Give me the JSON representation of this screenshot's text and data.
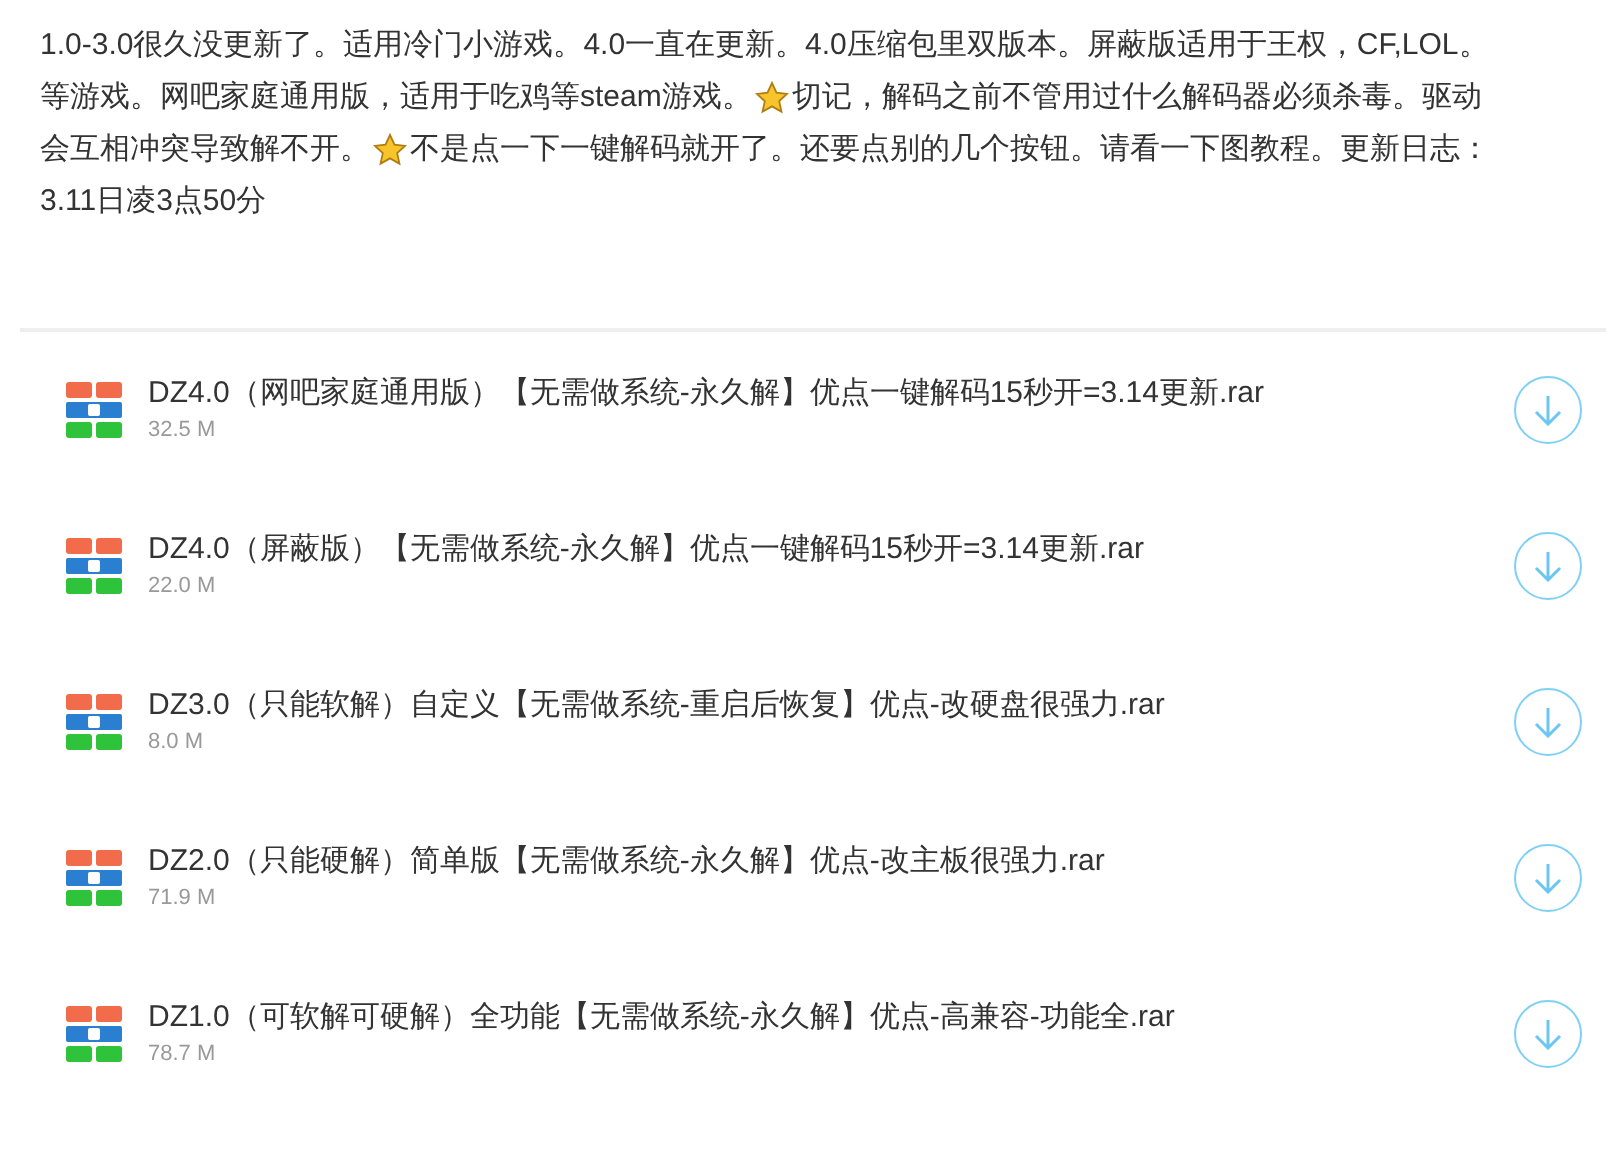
{
  "description": [
    [
      {
        "kind": "text",
        "text": "1.0-3.0很久没更新了。适用冷门小游戏。4.0一直在更新。4.0压缩包里双版本。屏蔽版适用于王权，CF,LOL。"
      }
    ],
    [
      {
        "kind": "text",
        "text": "等游戏。网吧家庭通用版，适用于吃鸡等steam游戏。"
      },
      {
        "kind": "star"
      },
      {
        "kind": "text",
        "text": "切记，解码之前不管用过什么解码器必须杀毒。驱动"
      }
    ],
    [
      {
        "kind": "text",
        "text": "会互相冲突导致解不开。"
      },
      {
        "kind": "star"
      },
      {
        "kind": "text",
        "text": "不是点一下一键解码就开了。还要点别的几个按钮。请看一下图教程。更新日志："
      }
    ],
    [
      {
        "kind": "text",
        "text": "3.11日凌3点50分"
      }
    ]
  ],
  "files": [
    {
      "name": "DZ4.0（网吧家庭通用版）【无需做系统-永久解】优点一键解码15秒开=3.14更新.rar",
      "size": "32.5 M"
    },
    {
      "name": "DZ4.0（屏蔽版）【无需做系统-永久解】优点一键解码15秒开=3.14更新.rar",
      "size": "22.0 M"
    },
    {
      "name": "DZ3.0（只能软解）自定义【无需做系统-重启后恢复】优点-改硬盘很强力.rar",
      "size": "8.0 M"
    },
    {
      "name": "DZ2.0（只能硬解）简单版【无需做系统-永久解】优点-改主板很强力.rar",
      "size": "71.9 M"
    },
    {
      "name": "DZ1.0（可软解可硬解）全功能【无需做系统-永久解】优点-高兼容-功能全.rar",
      "size": "78.7 M"
    }
  ]
}
